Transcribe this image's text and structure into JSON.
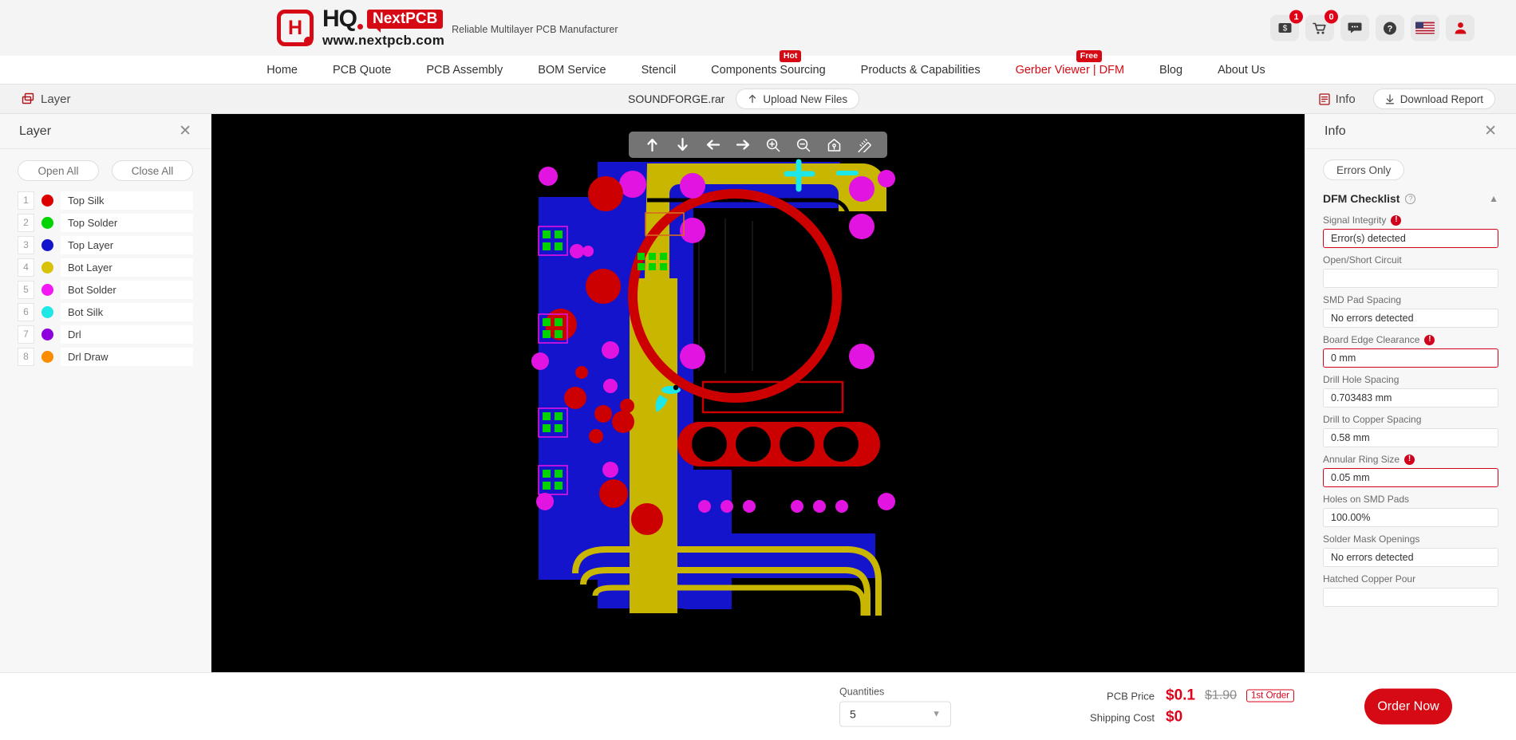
{
  "brand": {
    "mark_letter": "H",
    "hq": "HQ",
    "nextpcb": "NextPCB",
    "url": "www.nextpcb.com",
    "tagline": "Reliable Multilayer PCB Manufacturer",
    "accent_color": "#d60a14"
  },
  "header_icons": [
    {
      "name": "coupon-icon",
      "badge": "1"
    },
    {
      "name": "cart-icon",
      "badge": "0"
    },
    {
      "name": "chat-icon",
      "badge": ""
    },
    {
      "name": "help-icon",
      "badge": ""
    },
    {
      "name": "language-flag-icon",
      "badge": ""
    },
    {
      "name": "user-account-icon",
      "badge": ""
    }
  ],
  "nav": {
    "items": [
      {
        "label": "Home",
        "accent": false,
        "flag": ""
      },
      {
        "label": "PCB Quote",
        "accent": false,
        "flag": ""
      },
      {
        "label": "PCB Assembly",
        "accent": false,
        "flag": ""
      },
      {
        "label": "BOM Service",
        "accent": false,
        "flag": ""
      },
      {
        "label": "Stencil",
        "accent": false,
        "flag": ""
      },
      {
        "label": "Components Sourcing",
        "accent": false,
        "flag": "Hot"
      },
      {
        "label": "Products & Capabilities",
        "accent": false,
        "flag": ""
      },
      {
        "label": "Gerber Viewer | DFM",
        "accent": true,
        "flag": "Free"
      },
      {
        "label": "Blog",
        "accent": false,
        "flag": ""
      },
      {
        "label": "About Us",
        "accent": false,
        "flag": ""
      }
    ]
  },
  "subbar": {
    "layer_label": "Layer",
    "file_name": "SOUNDFORGE.rar",
    "upload_label": "Upload New Files",
    "info_label": "Info",
    "download_label": "Download Report"
  },
  "layer_panel": {
    "title": "Layer",
    "open_all": "Open All",
    "close_all": "Close All",
    "layers": [
      {
        "index": "1",
        "name": "Top Silk",
        "color": "#dd0000"
      },
      {
        "index": "2",
        "name": "Top Solder",
        "color": "#00d400"
      },
      {
        "index": "3",
        "name": "Top Layer",
        "color": "#1414cd"
      },
      {
        "index": "4",
        "name": "Bot Layer",
        "color": "#d9c308"
      },
      {
        "index": "5",
        "name": "Bot Solder",
        "color": "#f317f3"
      },
      {
        "index": "6",
        "name": "Bot Silk",
        "color": "#1de7e7"
      },
      {
        "index": "7",
        "name": "Drl",
        "color": "#8d00dd"
      },
      {
        "index": "8",
        "name": "Drl Draw",
        "color": "#fb8c00"
      }
    ]
  },
  "viewer_toolbar": [
    {
      "name": "pan-up-icon"
    },
    {
      "name": "pan-down-icon"
    },
    {
      "name": "pan-left-icon"
    },
    {
      "name": "pan-right-icon"
    },
    {
      "name": "zoom-in-icon"
    },
    {
      "name": "zoom-out-icon"
    },
    {
      "name": "home-reset-icon"
    },
    {
      "name": "measure-ruler-icon"
    }
  ],
  "info_panel": {
    "title": "Info",
    "errors_only": "Errors Only",
    "section_title": "DFM Checklist",
    "items": [
      {
        "label": "Signal Integrity",
        "value": "Error(s) detected",
        "error": true
      },
      {
        "label": "Open/Short Circuit",
        "value": "",
        "error": false
      },
      {
        "label": "SMD Pad Spacing",
        "value": "No errors detected",
        "error": false
      },
      {
        "label": "Board Edge Clearance",
        "value": "0 mm",
        "error": true
      },
      {
        "label": "Drill Hole Spacing",
        "value": "0.703483 mm",
        "error": false
      },
      {
        "label": "Drill to Copper Spacing",
        "value": "0.58 mm",
        "error": false
      },
      {
        "label": "Annular Ring Size",
        "value": "0.05 mm",
        "error": true
      },
      {
        "label": "Holes on SMD Pads",
        "value": "100.00%",
        "error": false
      },
      {
        "label": "Solder Mask Openings",
        "value": "No errors detected",
        "error": false
      },
      {
        "label": "Hatched Copper Pour",
        "value": "",
        "error": false
      }
    ]
  },
  "footer": {
    "quantities_label": "Quantities",
    "quantity_value": "5",
    "pcb_price_label": "PCB Price",
    "pcb_price": "$0.1",
    "pcb_price_old": "$1.90",
    "first_order_tag": "1st Order",
    "shipping_label": "Shipping Cost",
    "shipping_cost": "$0",
    "order_now": "Order Now"
  }
}
